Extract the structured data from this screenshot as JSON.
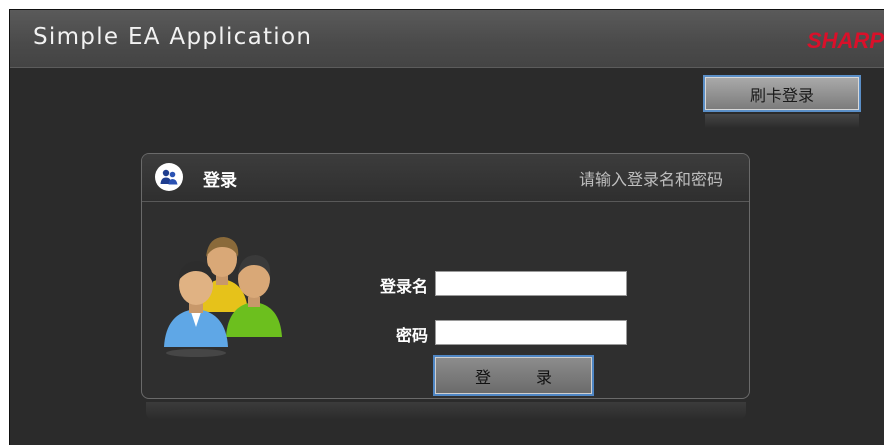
{
  "window": {
    "title": "Simple EA Application",
    "brand": "SHARP",
    "brand_color": "#d9102a"
  },
  "toolbar": {
    "card_login_label": "刷卡登录"
  },
  "login_panel": {
    "title": "登录",
    "hint": "请输入登录名和密码",
    "icon": "users-icon",
    "username": {
      "label": "登录名",
      "value": "",
      "placeholder": ""
    },
    "password": {
      "label": "密码",
      "value": "",
      "placeholder": ""
    },
    "submit_label": "登 录",
    "accent_color": "#4f86c4"
  }
}
